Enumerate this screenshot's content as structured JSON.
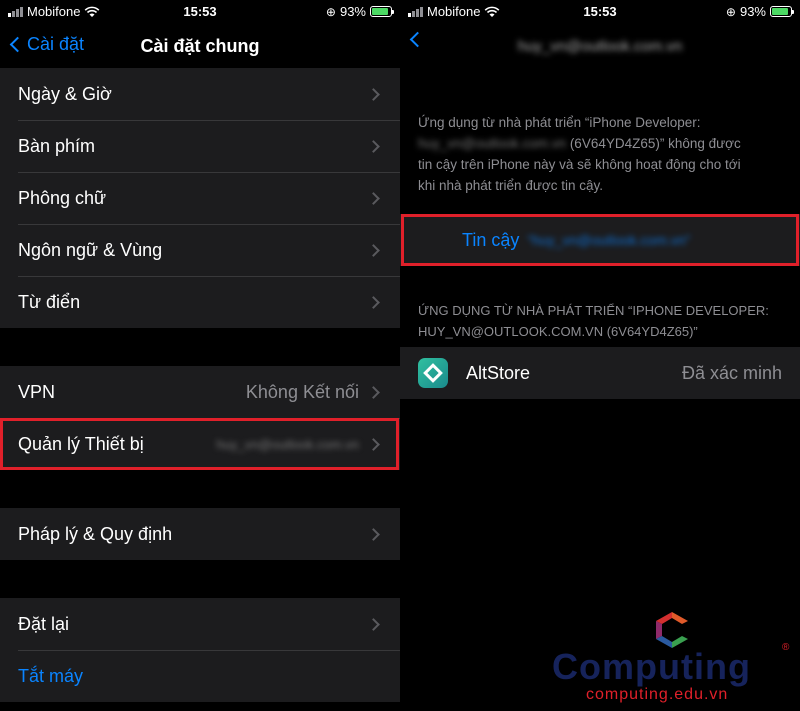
{
  "status": {
    "carrier": "Mobifone",
    "time": "15:53",
    "battery": "93%",
    "icons": [
      "signal-icon",
      "wifi-icon",
      "orientation-lock-icon",
      "battery-charging-icon"
    ]
  },
  "left": {
    "nav": {
      "back_label": "Cài đặt",
      "title": "Cài đặt chung"
    },
    "group1": [
      {
        "label": "Ngày & Giờ"
      },
      {
        "label": "Bàn phím"
      },
      {
        "label": "Phông chữ"
      },
      {
        "label": "Ngôn ngữ & Vùng"
      },
      {
        "label": "Từ điển"
      }
    ],
    "group2": [
      {
        "label": "VPN",
        "value": "Không Kết nối"
      },
      {
        "label": "Quản lý Thiết bị",
        "value": "huy_vn@outlook.com.vn"
      }
    ],
    "group3": [
      {
        "label": "Pháp lý & Quy định"
      }
    ],
    "group4": [
      {
        "label": "Đặt lại"
      },
      {
        "label": "Tắt máy"
      }
    ]
  },
  "right": {
    "nav": {
      "title": "huy_vn@outlook.com.vn"
    },
    "note_line1": "Ứng dụng từ nhà phát triển “iPhone Developer:",
    "note_line2_blur": "huy_vn@outlook.com.vn",
    "note_line2_rest": "(6V64YD4Z65)” không được",
    "note_line3": "tin cậy trên iPhone này và sẽ không hoạt động cho tới",
    "note_line4": "khi nhà phát triển được tin cậy.",
    "trust_label": "Tin cậy",
    "trust_email": "“huy_vn@outlook.com.vn”",
    "section_header_line1": "ỨNG DỤNG TỪ NHÀ PHÁT TRIỂN “IPHONE DEVELOPER:",
    "section_header_line2": "HUY_VN@OUTLOOK.COM.VN (6V64YD4Z65)”",
    "app": {
      "name": "AltStore",
      "status": "Đã xác minh"
    }
  },
  "watermark": {
    "name": "Computing",
    "url": "computing.edu.vn",
    "reg": "®"
  },
  "colors": {
    "accent": "#0a84ff",
    "highlight": "#e0202a",
    "cell_bg": "#1c1c1e"
  }
}
